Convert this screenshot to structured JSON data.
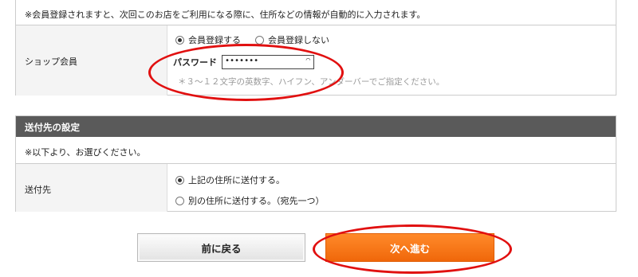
{
  "member_section": {
    "note": "※会員登録されますと、次回このお店をご利用になる際に、住所などの情報が自動的に入力されます。",
    "label": "ショップ会員",
    "options": [
      "会員登録する",
      "会員登録しない"
    ],
    "selected_option": "会員登録する",
    "password_label": "パスワード",
    "password_value": "•••••••",
    "password_hint": "＊３～１２文字の英数字、ハイフン、アンダーバーでご指定ください。"
  },
  "shipping_section": {
    "title": "送付先の設定",
    "instruction": "※以下より、お選びください。",
    "label": "送付先",
    "options": [
      "上記の住所に送付する。",
      "別の住所に送付する。（宛先一つ）"
    ],
    "selected_option": "上記の住所に送付する。"
  },
  "buttons": {
    "back": "前に戻る",
    "next": "次へ進む"
  },
  "colors": {
    "next_button": "#f26b0c",
    "header_bar": "#5a5a5a",
    "annotation": "#e11010"
  }
}
